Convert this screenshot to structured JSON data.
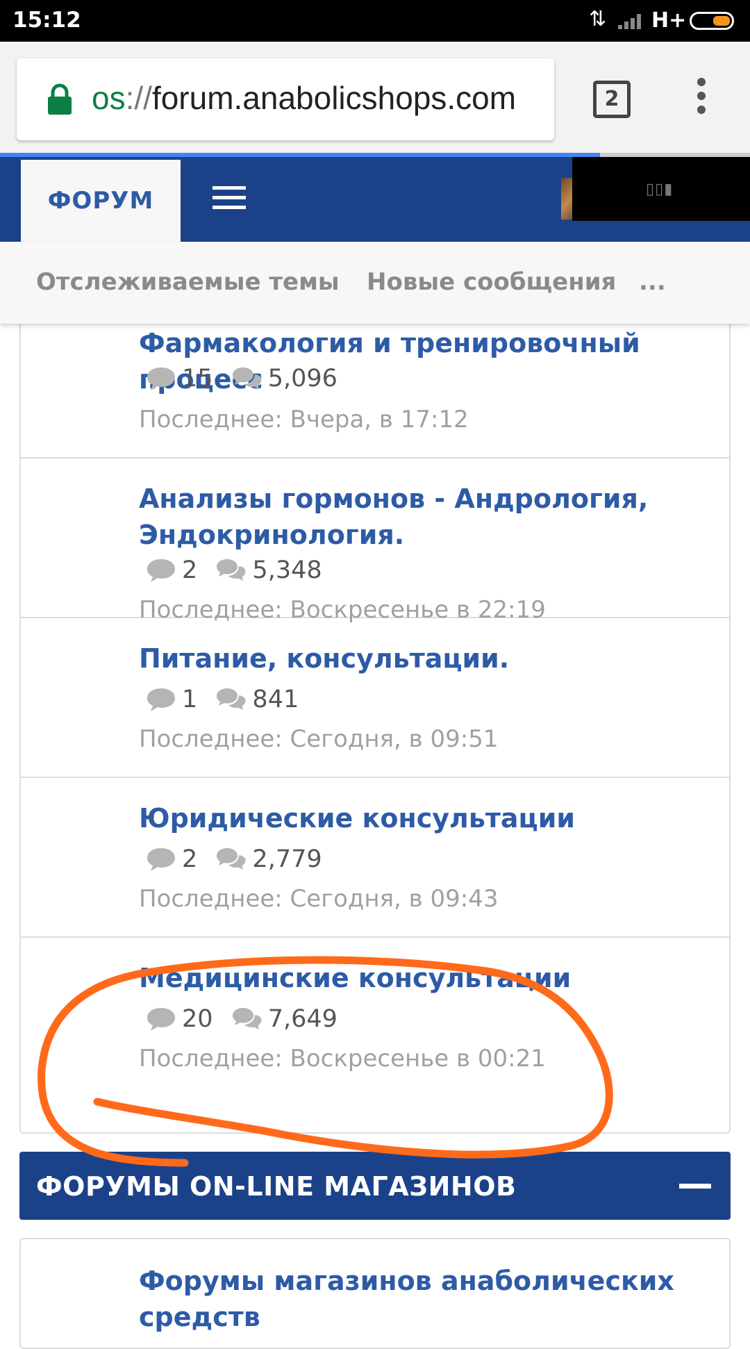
{
  "status_bar": {
    "time": "15:12",
    "network": "H+"
  },
  "browser": {
    "url_scheme": "os",
    "url_slashes": "://",
    "url_host": "forum.anabolicshops.com",
    "tab_count": "2"
  },
  "header": {
    "tab_label": "ФОРУМ"
  },
  "subnav": {
    "items": [
      "Отслеживаемые темы",
      "Новые сообщения",
      "..."
    ]
  },
  "forums": [
    {
      "title": "Фармакология и тренировочный процесс",
      "threads": "15",
      "messages": "5,096",
      "last": "Последнее: Вчера, в 17:12"
    },
    {
      "title": "Анализы гормонов - Андрология, Эндокринология.",
      "threads": "2",
      "messages": "5,348",
      "last": "Последнее: Воскресенье в 22:19"
    },
    {
      "title": "Питание, консультации.",
      "threads": "1",
      "messages": "841",
      "last": "Последнее: Сегодня, в 09:51"
    },
    {
      "title": "Юридические консультации",
      "threads": "2",
      "messages": "2,779",
      "last": "Последнее: Сегодня, в 09:43"
    },
    {
      "title": "Медицинские консультации",
      "threads": "20",
      "messages": "7,649",
      "last": "Последнее: Воскресенье в 00:21"
    }
  ],
  "category": {
    "title": "ФОРУМЫ ON-LINE МАГАЗИНОВ"
  },
  "forums2": [
    {
      "title": "Форумы магазинов анаболических средств"
    }
  ],
  "colors": {
    "brand": "#1b4289",
    "link": "#2d5ba6",
    "annotation": "#ff6a1a"
  }
}
